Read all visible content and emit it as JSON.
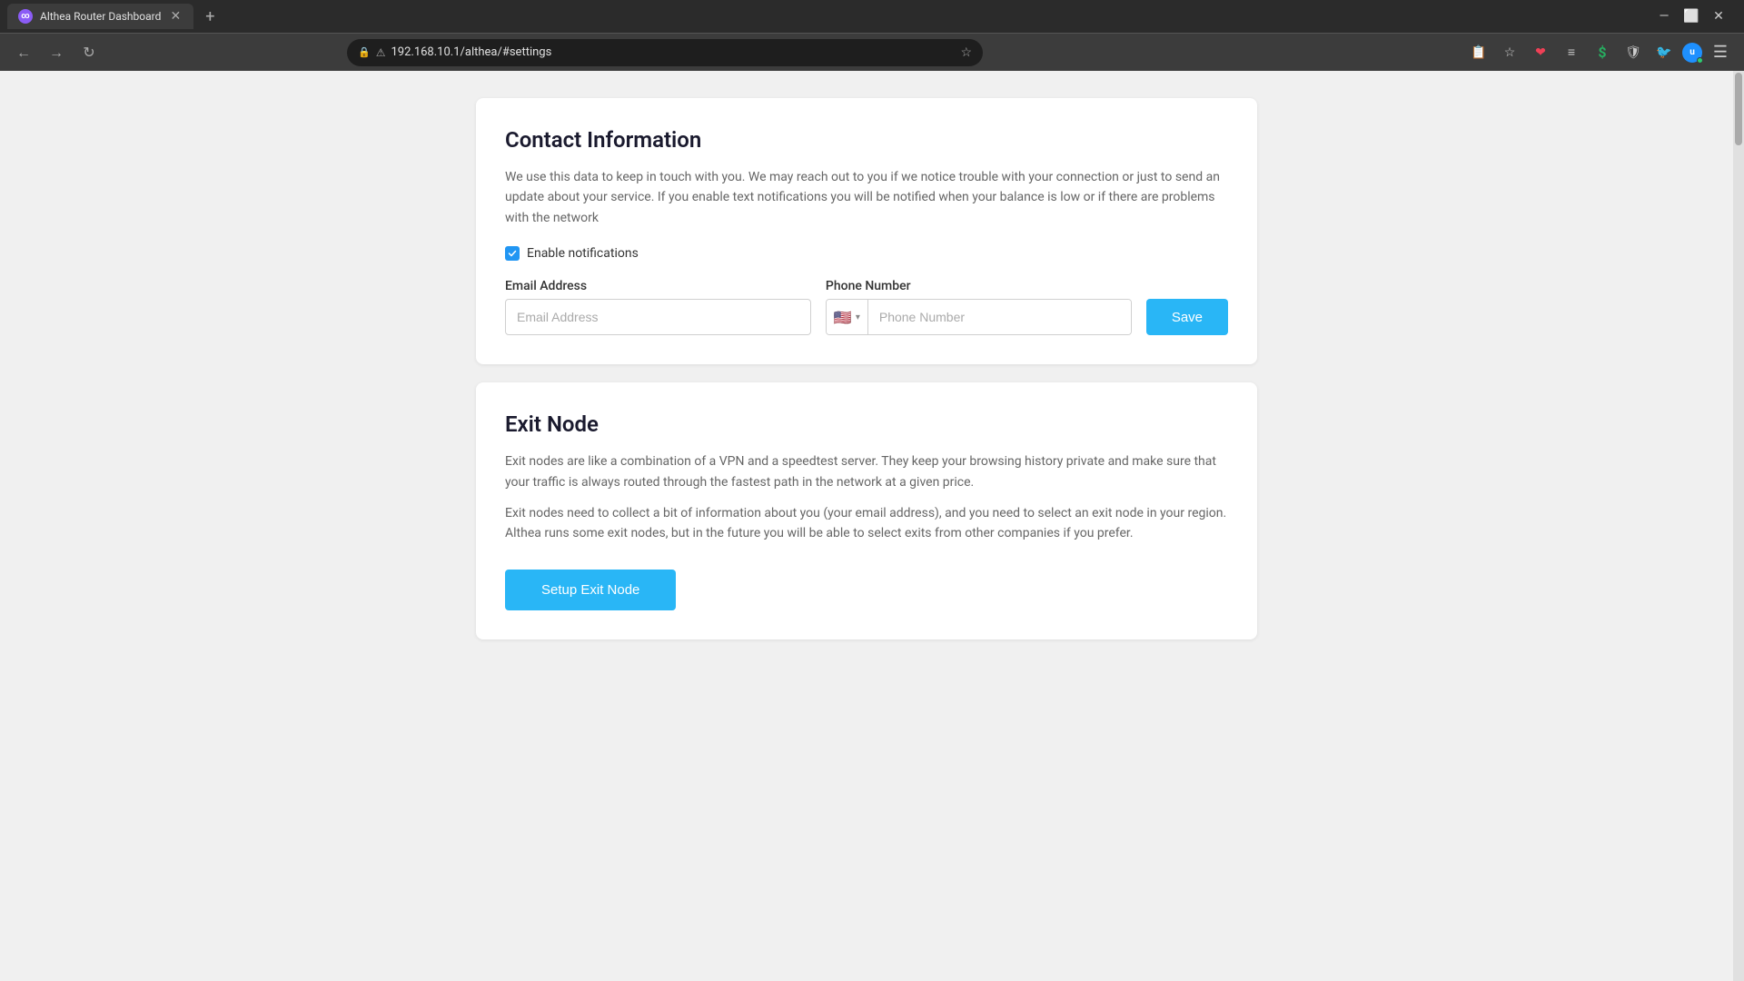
{
  "browser": {
    "tab_title": "Althea Router Dashboard",
    "url": "192.168.10.1/althea/#settings",
    "favicon_text": "∞",
    "new_tab_symbol": "+",
    "nav": {
      "back": "←",
      "forward": "→",
      "refresh": "↻"
    }
  },
  "contact_card": {
    "title": "Contact Information",
    "description": "We use this data to keep in touch with you. We may reach out to you if we notice trouble with your connection or just to send an update about your service. If you enable text notifications you will be notified when your balance is low or if there are problems with the network",
    "enable_notifications_label": "Enable notifications",
    "enable_notifications_checked": true,
    "email_label": "Email Address",
    "email_placeholder": "Email Address",
    "phone_label": "Phone Number",
    "phone_placeholder": "Phone Number",
    "phone_flag": "🇺🇸",
    "phone_caret": "▾",
    "save_label": "Save"
  },
  "exit_node_card": {
    "title": "Exit Node",
    "description1": "Exit nodes are like a combination of a VPN and a speedtest server. They keep your browsing history private and make sure that your traffic is always routed through the fastest path in the network at a given price.",
    "description2": "Exit nodes need to collect a bit of information about you (your email address), and you need to select an exit node in your region. Althea runs some exit nodes, but in the future you will be able to select exits from other companies if you prefer.",
    "setup_button_label": "Setup Exit Node"
  }
}
